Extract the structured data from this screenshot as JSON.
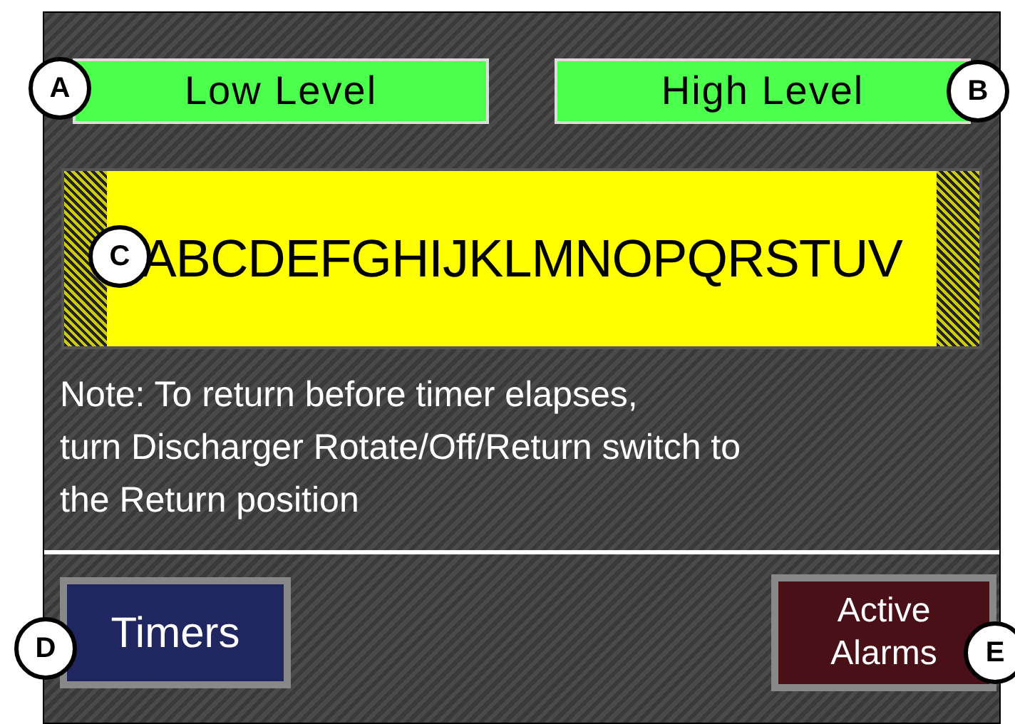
{
  "indicators": [
    {
      "label": "Low Level",
      "on": true
    },
    {
      "label": "High Level",
      "on": true
    }
  ],
  "message_display": {
    "text": "ABCDEFGHIJKLMNOPQRSTUV"
  },
  "note": [
    "Note: To return before timer elapses,",
    "turn Discharger Rotate/Off/Return switch to",
    "the Return position"
  ],
  "buttons": [
    {
      "label": "Timers",
      "kind": "navigate"
    },
    {
      "label": "Active Alarms",
      "kind": "alarm"
    }
  ],
  "callouts": [
    "A",
    "B",
    "C",
    "D",
    "E"
  ]
}
